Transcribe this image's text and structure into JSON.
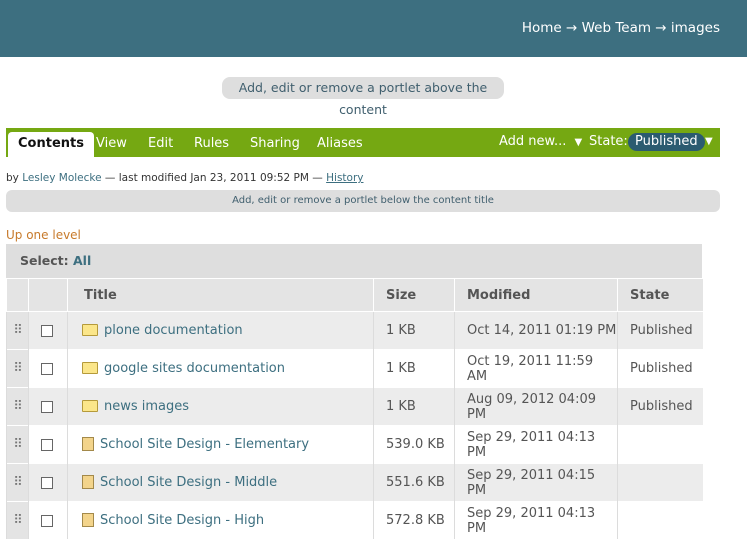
{
  "breadcrumb": {
    "home": "Home",
    "web_team": "Web Team",
    "current": "images",
    "arrow": "→"
  },
  "portlet_above": "Add, edit or remove a portlet above the content",
  "tabs": [
    "Contents",
    "View",
    "Edit",
    "Rules",
    "Sharing",
    "Aliases"
  ],
  "tab_right": {
    "add_new": "Add new...",
    "state_label": "State:",
    "state_value": "Published",
    "caret": "▼"
  },
  "byline": {
    "by": "by",
    "author": "Lesley Molecke",
    "modified": "— last modified Jan 23, 2011 09:52 PM —",
    "history": "History"
  },
  "portlet_below": "Add, edit or remove a portlet below the content title",
  "up_one_level": "Up one level",
  "select": {
    "label": "Select:",
    "all": "All"
  },
  "columns": {
    "title": "Title",
    "size": "Size",
    "modified": "Modified",
    "state": "State"
  },
  "rows": [
    {
      "type": "folder",
      "title": "plone documentation",
      "size": "1 KB",
      "modified": "Oct 14, 2011 01:19 PM",
      "state": "Published"
    },
    {
      "type": "folder",
      "title": "google sites documentation",
      "size": "1 KB",
      "modified": "Oct 19, 2011 11:59 AM",
      "state": "Published"
    },
    {
      "type": "folder",
      "title": "news images",
      "size": "1 KB",
      "modified": "Aug 09, 2012 04:09 PM",
      "state": "Published"
    },
    {
      "type": "image",
      "title": "School Site Design - Elementary",
      "size": "539.0 KB",
      "modified": "Sep 29, 2011 04:13 PM",
      "state": ""
    },
    {
      "type": "image",
      "title": "School Site Design - Middle",
      "size": "551.6 KB",
      "modified": "Sep 29, 2011 04:15 PM",
      "state": ""
    },
    {
      "type": "image",
      "title": "School Site Design - High",
      "size": "572.8 KB",
      "modified": "Sep 29, 2011 04:13 PM",
      "state": ""
    }
  ],
  "colors": {
    "header": "#3d6f80",
    "tabs": "#75a812",
    "link": "#3d6f80",
    "uplevel": "#c77a2b"
  }
}
